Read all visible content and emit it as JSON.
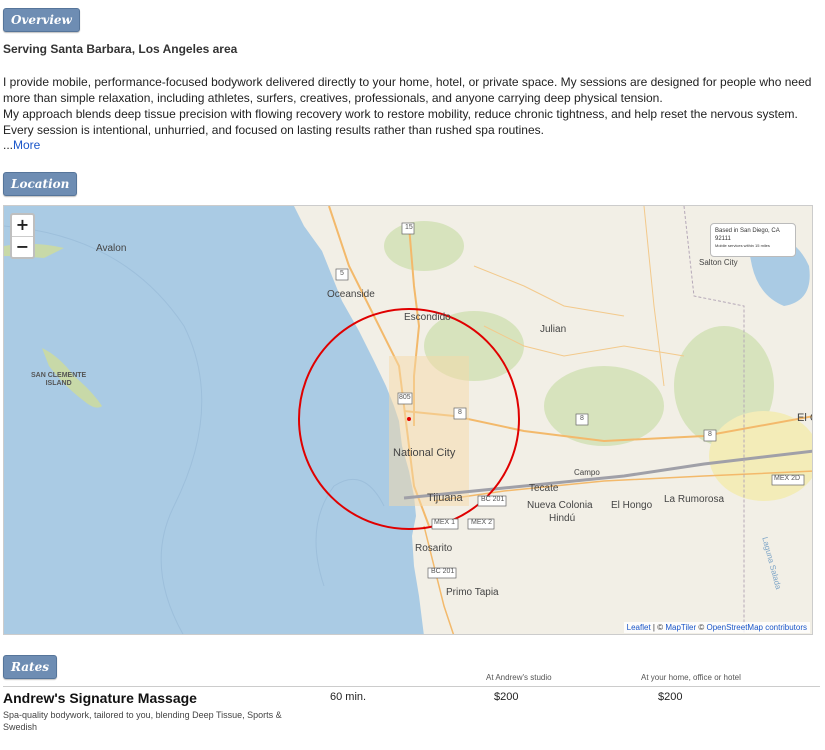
{
  "overview": {
    "badge": "Overview",
    "serving": "Serving Santa Barbara, Los Angeles area",
    "paragraph1": "I provide mobile, performance-focused bodywork delivered directly to your home, hotel, or private space. My sessions are designed for people who need more than simple relaxation, including athletes, surfers, creatives, professionals, and anyone carrying deep physical tension.",
    "paragraph2": "My approach blends deep tissue precision with flowing recovery work to restore mobility, reduce chronic tightness, and help reset the nervous system. Every session is intentional, unhurried, and focused on lasting results rather than rushed spa routines.",
    "more_prefix": "...",
    "more_link": "More"
  },
  "location": {
    "badge": "Location",
    "zoom_in": "+",
    "zoom_out": "−",
    "info_line1": "Based in San Diego, CA",
    "info_line2": "92111",
    "info_line3": "Mobile services within 15 miles",
    "attribution_leaflet": "Leaflet",
    "attribution_sep1": " | © ",
    "attribution_maptiler": "MapTiler",
    "attribution_sep2": " © ",
    "attribution_osm": "OpenStreetMap contributors",
    "places": {
      "avalon": "Avalon",
      "oceanside": "Oceanside",
      "escondido": "Escondido",
      "julian": "Julian",
      "salton_city": "Salton City",
      "san_clemente_island_1": "SAN CLEMENTE",
      "san_clemente_island_2": "ISLAND",
      "national_city": "National City",
      "tijuana": "Tijuana",
      "tecate": "Tecate",
      "campo": "Campo",
      "nueva_colonia": "Nueva Colonia",
      "hindu": "Hindú",
      "el_hongo": "El Hongo",
      "la_rumorosa": "La Rumorosa",
      "rosarito": "Rosarito",
      "primo_tapia": "Primo Tapia",
      "el_c": "El C",
      "laguna_salada": "Laguna Salada"
    },
    "shields": {
      "i15": "15",
      "i5": "5",
      "i805": "805",
      "i8a": "8",
      "i8b": "8",
      "i8c": "8",
      "bc201a": "BC 201",
      "bc201b": "BC 201",
      "mex1": "MEX 1",
      "mex2": "MEX 2",
      "mex2d": "MEX 2D"
    },
    "colors": {
      "water": "#aacbe4",
      "land": "#f2efe6",
      "road": "#f3b96b",
      "radius": "#e00000"
    }
  },
  "rates": {
    "badge": "Rates",
    "col_studio": "At Andrew's studio",
    "col_home": "At your home, office or hotel",
    "services": [
      {
        "name": "Andrew's Signature Massage",
        "description": "Spa-quality bodywork, tailored to you, blending Deep Tissue, Sports & Swedish",
        "duration": "60 min.",
        "studio_price": "$200",
        "home_price": "$200"
      }
    ]
  }
}
